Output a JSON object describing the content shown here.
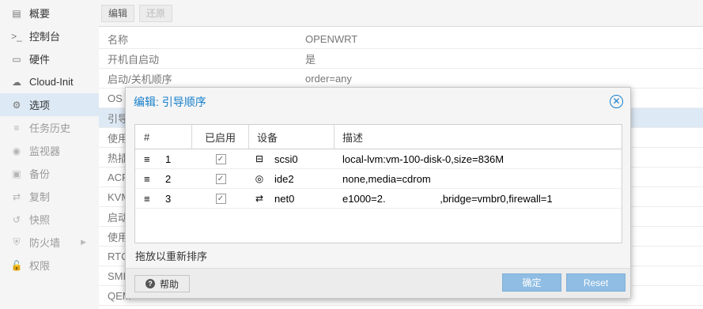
{
  "sidebar": {
    "items": [
      {
        "label": "概要",
        "icon": "book-icon",
        "glyph": "▤"
      },
      {
        "label": "控制台",
        "icon": "terminal-icon",
        "glyph": ">_"
      },
      {
        "label": "硬件",
        "icon": "monitor-icon",
        "glyph": "▭"
      },
      {
        "label": "Cloud-Init",
        "icon": "cloud-icon",
        "glyph": "☁"
      },
      {
        "label": "选项",
        "icon": "gear-icon",
        "glyph": "⚙"
      },
      {
        "label": "任务历史",
        "icon": "list-icon",
        "glyph": "≡"
      },
      {
        "label": "监视器",
        "icon": "eye-icon",
        "glyph": "◉"
      },
      {
        "label": "备份",
        "icon": "floppy-icon",
        "glyph": "▣"
      },
      {
        "label": "复制",
        "icon": "retweet-icon",
        "glyph": "⇄"
      },
      {
        "label": "快照",
        "icon": "history-icon",
        "glyph": "↺"
      },
      {
        "label": "防火墙",
        "icon": "shield-icon",
        "glyph": "⛨"
      },
      {
        "label": "权限",
        "icon": "unlock-icon",
        "glyph": "🔓"
      }
    ]
  },
  "toolbar": {
    "edit_label": "编辑",
    "revert_label": "还原"
  },
  "options": {
    "rows": [
      {
        "key": "名称",
        "value": "OPENWRT"
      },
      {
        "key": "开机自启动",
        "value": "是"
      },
      {
        "key": "启动/关机顺序",
        "value": "order=any"
      },
      {
        "key": "OS",
        "value": ""
      },
      {
        "key": "引导",
        "value": ""
      },
      {
        "key": "使用",
        "value": ""
      },
      {
        "key": "热插",
        "value": ""
      },
      {
        "key": "ACP",
        "value": ""
      },
      {
        "key": "KVM",
        "value": ""
      },
      {
        "key": "启动",
        "value": ""
      },
      {
        "key": "使用",
        "value": ""
      },
      {
        "key": "RTC",
        "value": ""
      },
      {
        "key": "SMI",
        "value": ""
      },
      {
        "key": "QEM",
        "value": ""
      }
    ]
  },
  "dialog": {
    "title": "编辑: 引导顺序",
    "close_glyph": "✕",
    "columns": {
      "num": "#",
      "enabled": "已启用",
      "device": "设备",
      "desc": "描述"
    },
    "rows": [
      {
        "num": "1",
        "enabled": true,
        "device": "scsi0",
        "device_icon": "hdd-icon",
        "device_glyph": "⊟",
        "desc": "local-lvm:vm-100-disk-0,size=836M"
      },
      {
        "num": "2",
        "enabled": true,
        "device": "ide2",
        "device_icon": "cdrom-icon",
        "device_glyph": "◎",
        "desc": "none,media=cdrom"
      },
      {
        "num": "3",
        "enabled": true,
        "device": "net0",
        "device_icon": "exchange-icon",
        "device_glyph": "⇄",
        "desc": "e1000=2.                   ,bridge=vmbr0,firewall=1"
      }
    ],
    "hint": "拖放以重新排序",
    "help_label": "帮助",
    "ok_label": "确定",
    "reset_label": "Reset"
  }
}
